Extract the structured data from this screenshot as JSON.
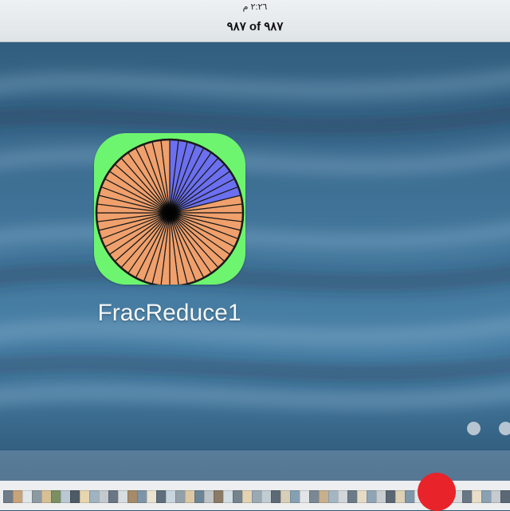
{
  "status_bar": {
    "time": "٢:٢٦ م"
  },
  "nav": {
    "photo_counter": "٩٨٧ of ٩٨٧"
  },
  "app": {
    "name": "FracReduce1",
    "icon_background": "#6df56f",
    "pie_colors": {
      "filled": "#6b6ff0",
      "empty": "#f0a06c",
      "line": "#1a1a1a"
    },
    "icon_fraction": {
      "filled_slices": 11,
      "total_slices": 52
    }
  },
  "wallpaper": {
    "colors": [
      "#2f5878",
      "#3d6f93",
      "#4a82a8",
      "#234866"
    ]
  },
  "page_indicator": {
    "count": 2
  },
  "photo_strip": {
    "thumb_colors": [
      "#6f7c8a",
      "#c9a37a",
      "#e2e7ea",
      "#8d9aa2",
      "#d7c095",
      "#7b8f63",
      "#b9c8d2",
      "#4e5b66",
      "#e8d6b0",
      "#9fb3c0",
      "#c3c9cc",
      "#6a7685",
      "#d8dde0",
      "#a58b6a",
      "#7d95a8",
      "#eae3cf",
      "#5f6e7c",
      "#c8d5de",
      "#94a0a9",
      "#dcc9a4",
      "#6c8596",
      "#bfc4c6",
      "#8a7a66",
      "#d3dde3",
      "#75838f",
      "#e4d3b3",
      "#9aa9b4",
      "#c1ccd3",
      "#5d6a76",
      "#d9cfb8",
      "#86a0b3",
      "#e1e5e7",
      "#7a8895",
      "#c9b08c",
      "#a4b6c3",
      "#d0d6d9",
      "#6b7a87",
      "#e6dcc6",
      "#8fa5b6",
      "#c7cdd0",
      "#5a6773",
      "#ddd0b4",
      "#7f97aa",
      "#e3e7e9",
      "#93a2ad",
      "#cbb693",
      "#a8bac7",
      "#d4d9dc",
      "#687784",
      "#e9dfc8",
      "#8aa1b4",
      "#c5cbce",
      "#5c6975",
      "#dbd2bc"
    ]
  }
}
